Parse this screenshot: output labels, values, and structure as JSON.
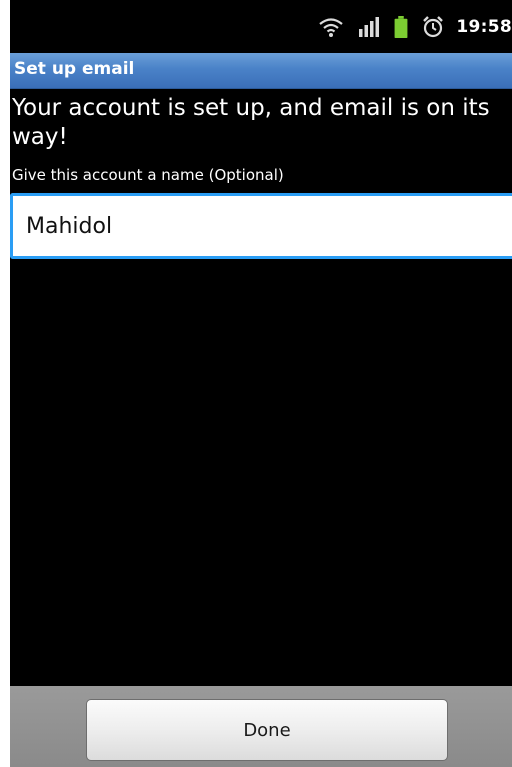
{
  "status_bar": {
    "time": "19:58",
    "icons": [
      "wifi-icon",
      "signal-icon",
      "battery-icon",
      "alarm-icon"
    ],
    "battery_color": "#7ccd32"
  },
  "title_bar": {
    "title": "Set up email",
    "color": "#4a82c8"
  },
  "main": {
    "heading": "Your account is set up, and email is on its way!",
    "account_name_label": "Give this account a name (Optional)",
    "account_name_value": "Mahidol",
    "accent_color": "#2a9df4"
  },
  "footer": {
    "done_label": "Done"
  }
}
